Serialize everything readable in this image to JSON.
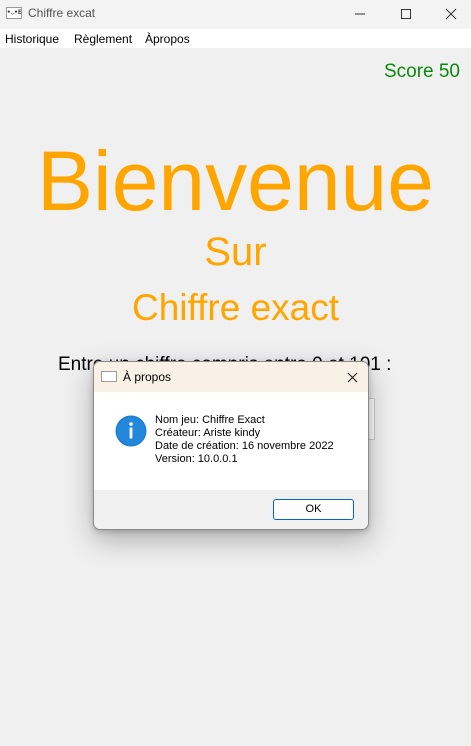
{
  "window": {
    "title": "Chiffre excat",
    "app_icon_text": "•◡•E"
  },
  "menu": {
    "items": [
      {
        "label": "Historique"
      },
      {
        "label": "Règlement"
      },
      {
        "label": "Àpropos"
      }
    ]
  },
  "main": {
    "score": "Score 50",
    "welcome": "Bienvenue",
    "on": "Sur",
    "app_name": "Chiffre exact",
    "prompt": "Entre  un chiffre compris entre 0 et 101 :"
  },
  "dialog": {
    "title": "À propos",
    "lines": [
      "Nom jeu: Chiffre Exact",
      "Créateur: Ariste kindy",
      "Date de création: 16 novembre 2022",
      "Version: 10.0.0.1"
    ],
    "ok_label": "OK"
  },
  "colors": {
    "accent_orange": "#ffa500",
    "score_green": "#0a8a0a",
    "ok_border": "#0067c0",
    "info_blue": "#1e7fd1"
  },
  "icons": {
    "app": "app-icon",
    "minimize": "minimize-icon",
    "maximize": "maximize-icon",
    "close": "close-icon",
    "info": "info-icon"
  }
}
